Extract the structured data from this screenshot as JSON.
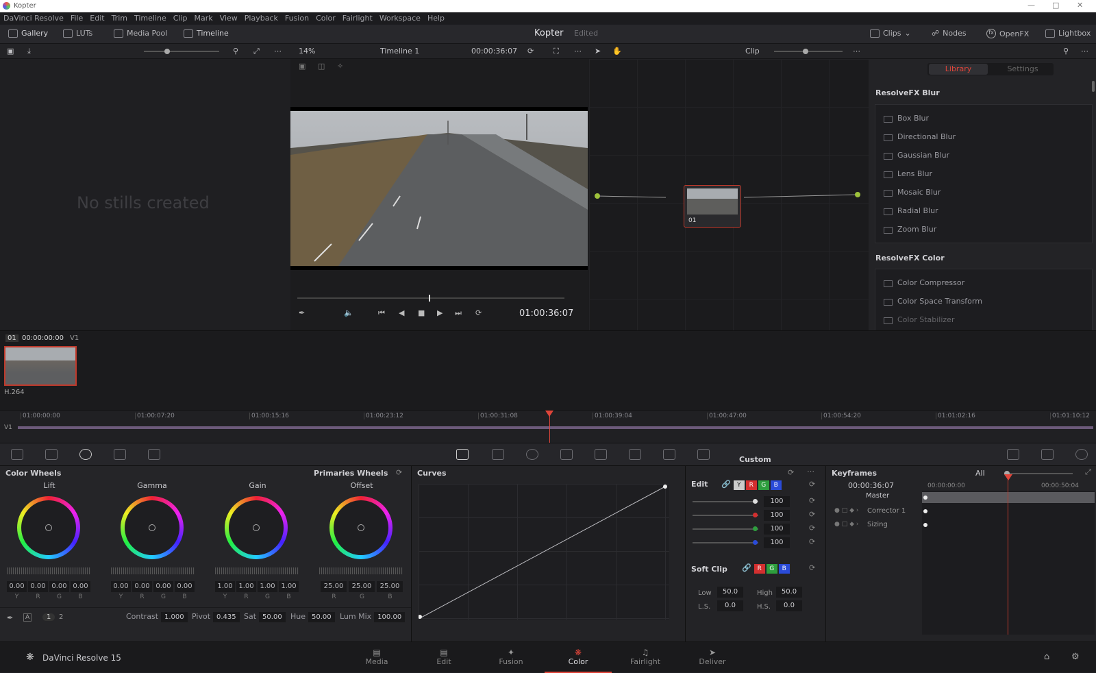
{
  "window": {
    "title": "Kopter"
  },
  "menu": [
    "DaVinci Resolve",
    "File",
    "Edit",
    "Trim",
    "Timeline",
    "Clip",
    "Mark",
    "View",
    "Playback",
    "Fusion",
    "Color",
    "Fairlight",
    "Workspace",
    "Help"
  ],
  "toolbar": {
    "gallery": "Gallery",
    "luts": "LUTs",
    "media_pool": "Media Pool",
    "timeline": "Timeline",
    "project": "Kopter",
    "status": "Edited",
    "clips": "Clips",
    "nodes": "Nodes",
    "openfx": "OpenFX",
    "lightbox": "Lightbox"
  },
  "viewer": {
    "zoom": "14%",
    "timeline_name": "Timeline 1",
    "timecode_top": "00:00:36:07",
    "timecode": "01:00:36:07",
    "clip_mode": "Clip"
  },
  "gallery": {
    "empty_text": "No stills created"
  },
  "node": {
    "label": "01"
  },
  "library": {
    "tab_library": "Library",
    "tab_settings": "Settings",
    "group1": "ResolveFX Blur",
    "blur_items": [
      "Box Blur",
      "Directional Blur",
      "Gaussian Blur",
      "Lens Blur",
      "Mosaic Blur",
      "Radial Blur",
      "Zoom Blur"
    ],
    "group2": "ResolveFX Color",
    "color_items": [
      "Color Compressor",
      "Color Space Transform",
      "Color Stabilizer"
    ]
  },
  "clip": {
    "number": "01",
    "timecode": "00:00:00:00",
    "track": "V1",
    "codec": "H.264"
  },
  "ruler": {
    "ticks": [
      "01:00:00:00",
      "01:00:07:20",
      "01:00:15:16",
      "01:00:23:12",
      "01:00:31:08",
      "01:00:39:04",
      "01:00:47:00",
      "01:00:54:20",
      "01:01:02:16",
      "01:01:10:12"
    ],
    "track": "V1"
  },
  "wheels": {
    "title": "Color Wheels",
    "mode": "Primaries Wheels",
    "lift": {
      "label": "Lift",
      "values": [
        "0.00",
        "0.00",
        "0.00",
        "0.00"
      ],
      "channels": [
        "Y",
        "R",
        "G",
        "B"
      ]
    },
    "gamma": {
      "label": "Gamma",
      "values": [
        "0.00",
        "0.00",
        "0.00",
        "0.00"
      ],
      "channels": [
        "Y",
        "R",
        "G",
        "B"
      ]
    },
    "gain": {
      "label": "Gain",
      "values": [
        "1.00",
        "1.00",
        "1.00",
        "1.00"
      ],
      "channels": [
        "Y",
        "R",
        "G",
        "B"
      ]
    },
    "offset": {
      "label": "Offset",
      "values": [
        "25.00",
        "25.00",
        "25.00"
      ],
      "channels": [
        "R",
        "G",
        "B"
      ]
    },
    "bottom": {
      "page1": "1",
      "page2": "2",
      "contrast_label": "Contrast",
      "contrast": "1.000",
      "pivot_label": "Pivot",
      "pivot": "0.435",
      "sat_label": "Sat",
      "sat": "50.00",
      "hue_label": "Hue",
      "hue": "50.00",
      "lummix_label": "Lum Mix",
      "lummix": "100.00"
    }
  },
  "curves": {
    "title": "Curves",
    "mode": "Custom"
  },
  "edit": {
    "title": "Edit",
    "y": "Y",
    "r": "R",
    "g": "G",
    "b": "B",
    "values": [
      "100",
      "100",
      "100",
      "100"
    ],
    "softclip": "Soft Clip",
    "low_label": "Low",
    "low": "50.0",
    "high_label": "High",
    "high": "50.0",
    "ls_label": "L.S.",
    "ls": "0.0",
    "hs_label": "H.S.",
    "hs": "0.0"
  },
  "keyframes": {
    "title": "Keyframes",
    "filter": "All",
    "timecode": "00:00:36:07",
    "t0": "00:00:00:00",
    "t1": "00:00:50:04",
    "rows": [
      "Master",
      "Corrector 1",
      "Sizing"
    ]
  },
  "pages": {
    "app": "DaVinci Resolve 15",
    "items": [
      "Media",
      "Edit",
      "Fusion",
      "Color",
      "Fairlight",
      "Deliver"
    ],
    "active": "Color"
  },
  "colors": {
    "accent": "#e0453a",
    "bg": "#1f1f22",
    "red": "#d32f2f",
    "green": "#2e9e3e",
    "blue": "#2a4bd8"
  }
}
